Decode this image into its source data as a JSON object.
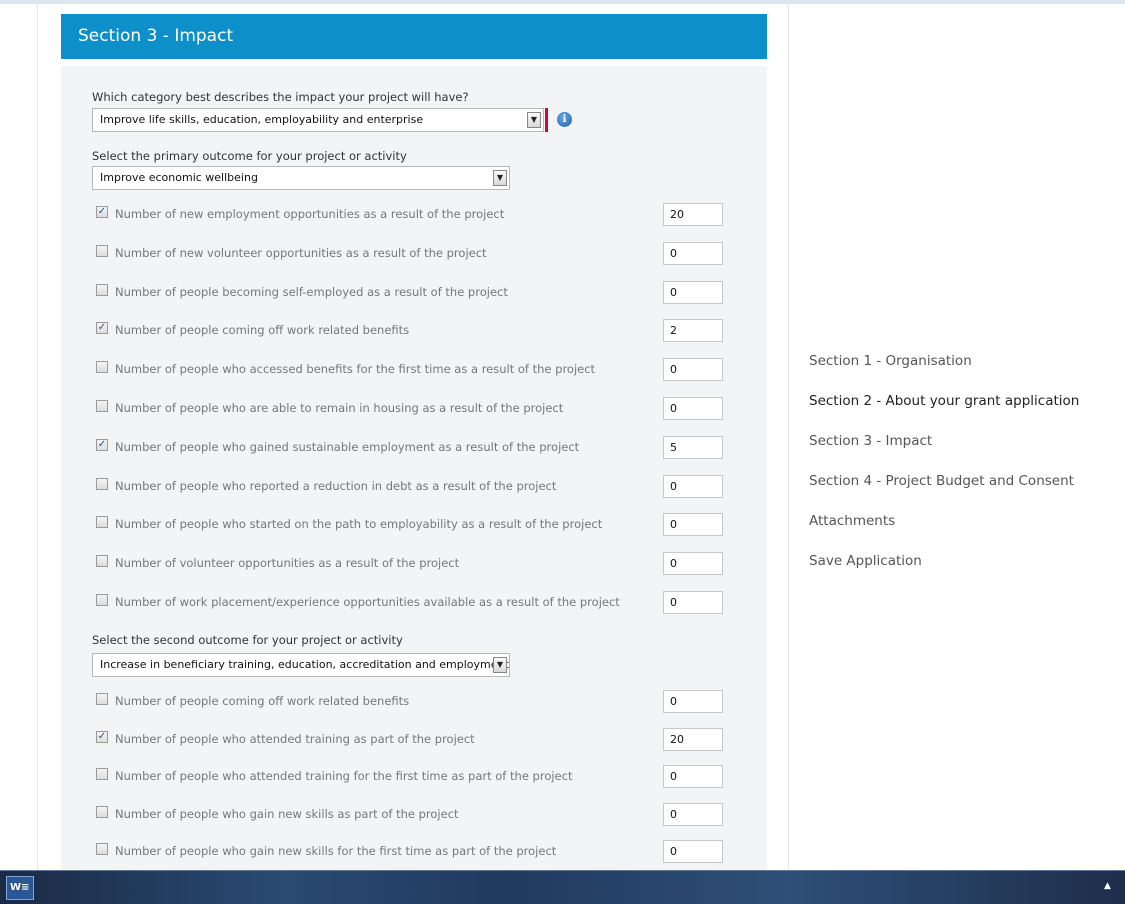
{
  "section_title": "Section 3 - Impact",
  "category": {
    "label": "Which category best describes the impact your project will have?",
    "value": "Improve life skills, education, employability and enterprise"
  },
  "primary": {
    "label": "Select the primary outcome for your project or activity",
    "value": "Improve economic wellbeing",
    "items": [
      {
        "label": "Number of new employment opportunities as a result of the project",
        "checked": true,
        "value": "20"
      },
      {
        "label": "Number of new volunteer opportunities as a result of the project",
        "checked": false,
        "value": "0"
      },
      {
        "label": "Number of people becoming self-employed as a result of the project",
        "checked": false,
        "value": "0"
      },
      {
        "label": "Number of people coming off work related benefits",
        "checked": true,
        "value": "2"
      },
      {
        "label": "Number of people who accessed benefits for the first time as a result of the project",
        "checked": false,
        "value": "0"
      },
      {
        "label": "Number of people who are able to remain in housing as a result of the project",
        "checked": false,
        "value": "0"
      },
      {
        "label": "Number of people who gained sustainable employment as a result of the project",
        "checked": true,
        "value": "5"
      },
      {
        "label": "Number of people who reported a reduction in debt as a result of the project",
        "checked": false,
        "value": "0"
      },
      {
        "label": "Number of people who started on the path to employability as a result of the project",
        "checked": false,
        "value": "0"
      },
      {
        "label": "Number of volunteer opportunities as a result of the project",
        "checked": false,
        "value": "0"
      },
      {
        "label": "Number of work placement/experience opportunities available as a result of the project",
        "checked": false,
        "value": "0"
      }
    ]
  },
  "second": {
    "label": "Select the second outcome for your project or activity",
    "value": "Increase in beneficiary training, education, accreditation and employment",
    "items": [
      {
        "label": "Number of people coming off work related benefits",
        "checked": false,
        "value": "0"
      },
      {
        "label": "Number of people who attended training as part of the project",
        "checked": true,
        "value": "20"
      },
      {
        "label": "Number of people who attended training for the first time as part of the project",
        "checked": false,
        "value": "0"
      },
      {
        "label": "Number of people who gain new skills as part of the project",
        "checked": false,
        "value": "0"
      },
      {
        "label": "Number of people who gain new skills for the first time as part of the project",
        "checked": false,
        "value": "0"
      }
    ]
  },
  "nav": [
    "Section 1 - Organisation",
    "Section 2 - About your grant application",
    "Section 3 - Impact",
    "Section 4 - Project Budget and Consent",
    "Attachments",
    "Save Application"
  ],
  "icons": {
    "dropdown": "chevron-down-icon",
    "info": "info-icon",
    "checkbox_checked": "✓",
    "taskbar_app": "word-icon"
  }
}
